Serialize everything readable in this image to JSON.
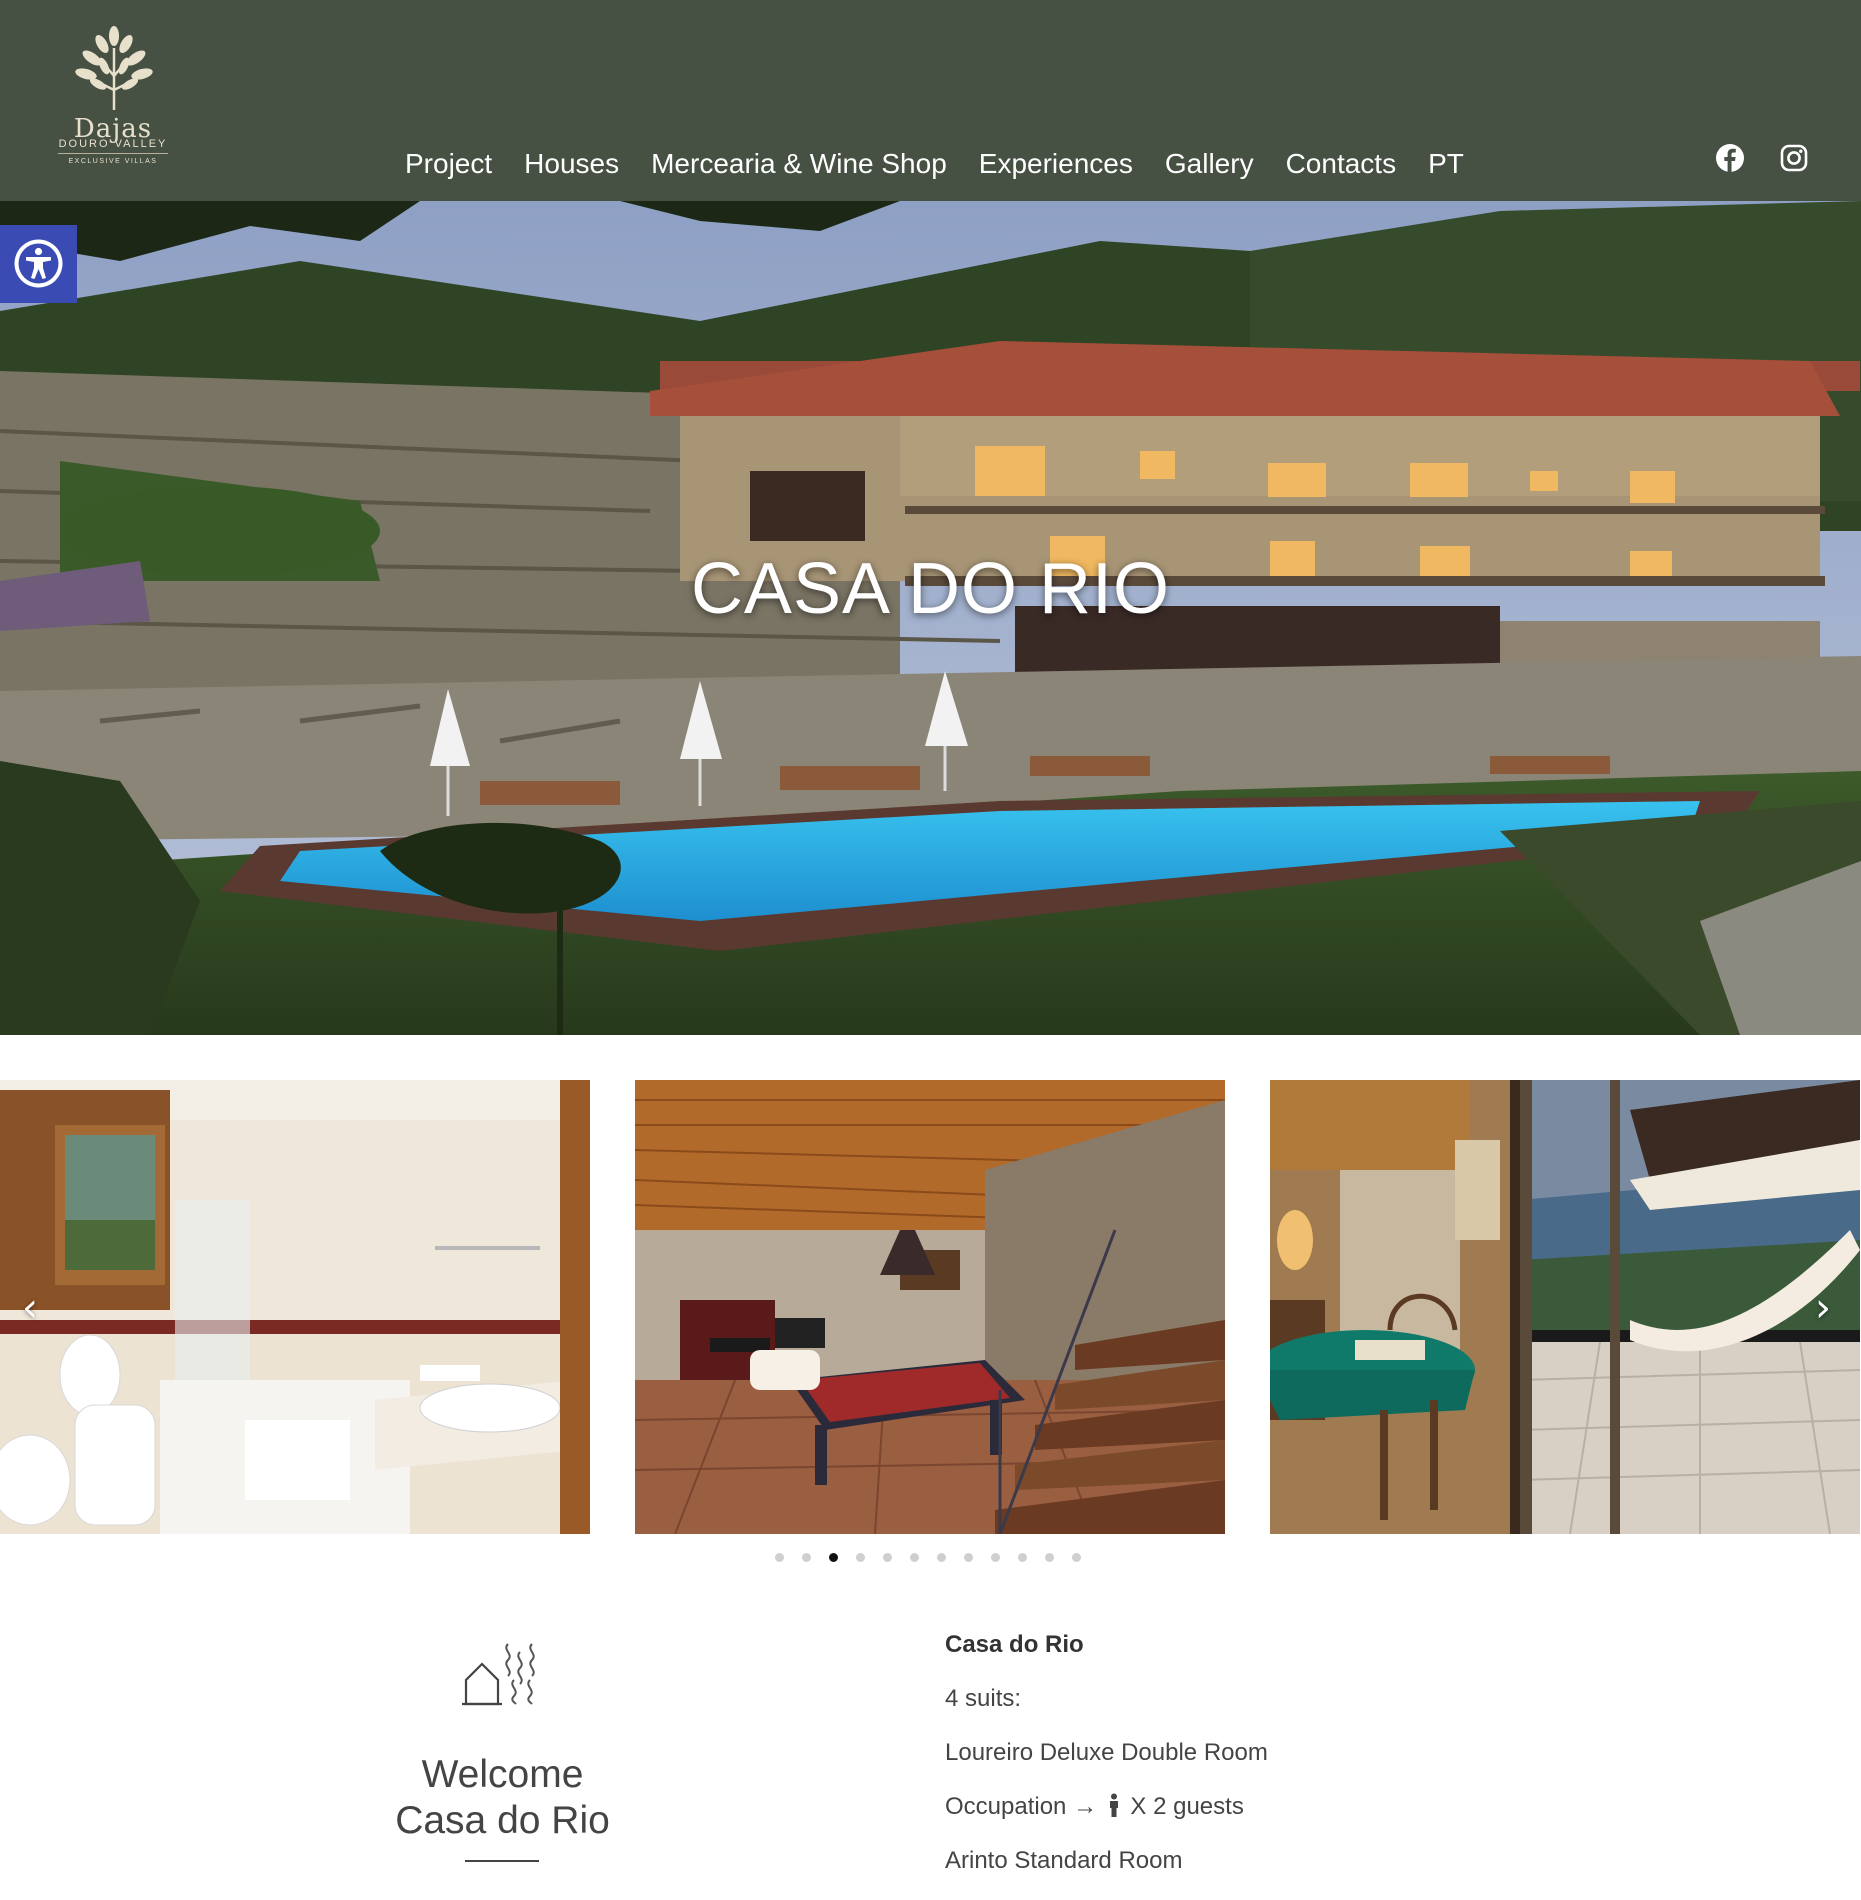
{
  "header": {
    "logo": {
      "name": "Dajas",
      "region": "DOURO VALLEY",
      "tagline": "EXCLUSIVE VILLAS"
    },
    "nav": [
      {
        "label": "Project"
      },
      {
        "label": "Houses"
      },
      {
        "label": "Mercearia & Wine Shop"
      },
      {
        "label": "Experiences"
      },
      {
        "label": "Gallery"
      },
      {
        "label": "Contacts"
      },
      {
        "label": "PT"
      }
    ],
    "social": [
      {
        "icon": "facebook-icon"
      },
      {
        "icon": "instagram-icon"
      }
    ],
    "background_color": "#465043"
  },
  "accessibility": {
    "icon": "accessibility-icon",
    "color": "#3a4cb4"
  },
  "hero": {
    "title": "CASA DO RIO"
  },
  "carousel": {
    "slides": [
      {
        "subject": "bathroom"
      },
      {
        "subject": "living-room-pool-table"
      },
      {
        "subject": "game-room-balcony-hammock"
      }
    ],
    "prev_icon": "chevron-left-icon",
    "next_icon": "chevron-right-icon",
    "dot_count": 12,
    "active_dot": 3
  },
  "welcome": {
    "icon": "house-hot-spring-icon",
    "title_line1": "Welcome",
    "title_line2": "Casa do Rio"
  },
  "info": {
    "heading": "Casa do Rio",
    "suites": "4 suits:",
    "room1": "Loureiro Deluxe Double Room",
    "occupation_prefix": "Occupation →",
    "occupation_suffix": "X 2 guests",
    "room2": "Arinto Standard Room"
  }
}
